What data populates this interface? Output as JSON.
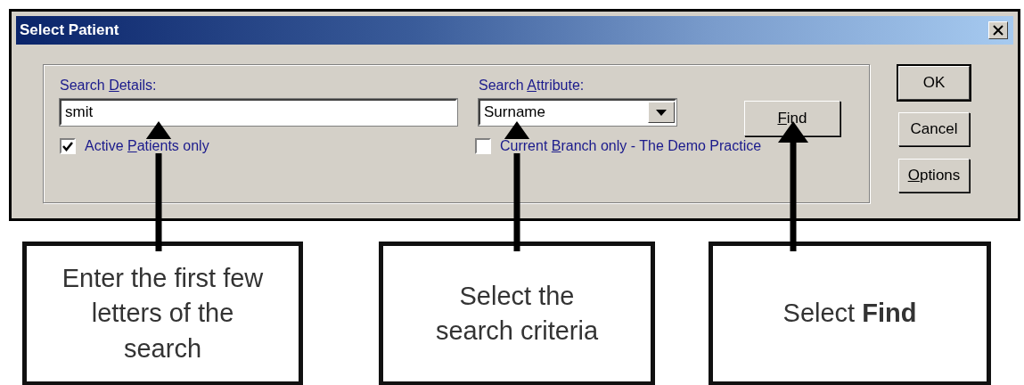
{
  "window": {
    "title": "Select Patient"
  },
  "search_details": {
    "label": [
      {
        "text": "Search ",
        "underlined": false
      },
      {
        "text": "D",
        "underlined": true
      },
      {
        "text": "etails:",
        "underlined": false
      }
    ],
    "value": "smit"
  },
  "active_patients_only": {
    "label": [
      {
        "text": "Active ",
        "underlined": false
      },
      {
        "text": "P",
        "underlined": true
      },
      {
        "text": "atients only",
        "underlined": false
      }
    ],
    "checked": true
  },
  "search_attribute": {
    "label": [
      {
        "text": "Search ",
        "underlined": false
      },
      {
        "text": "A",
        "underlined": true
      },
      {
        "text": "ttribute:",
        "underlined": false
      }
    ],
    "value": "Surname"
  },
  "current_branch_only": {
    "label": [
      {
        "text": "Current ",
        "underlined": false
      },
      {
        "text": "B",
        "underlined": true
      },
      {
        "text": "ranch only - The Demo Practice",
        "underlined": false
      }
    ],
    "checked": false
  },
  "find_button": {
    "label": [
      {
        "text": "F",
        "underlined": true
      },
      {
        "text": "ind",
        "underlined": false
      }
    ]
  },
  "side_buttons": [
    {
      "label": [
        {
          "text": "OK",
          "underlined": false
        }
      ],
      "default": true
    },
    {
      "label": [
        {
          "text": "Cancel",
          "underlined": false
        }
      ],
      "default": false
    },
    {
      "label": [
        {
          "text": "O",
          "underlined": true
        },
        {
          "text": "ptions",
          "underlined": false
        }
      ],
      "default": false
    }
  ],
  "callouts": [
    {
      "text": "Enter the first few letters of the search"
    },
    {
      "text": "Select the search criteria"
    },
    {
      "text": "Select **Find**"
    }
  ]
}
